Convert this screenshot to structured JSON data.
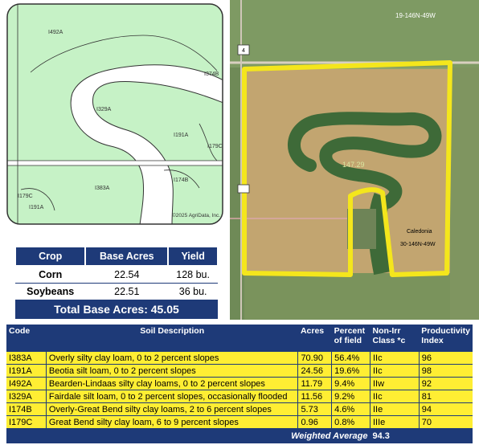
{
  "soil_map": {
    "labels": [
      "I492A",
      "I329A",
      "I191A",
      "I179C",
      "I383A",
      "I174B",
      "I179C",
      "I191A",
      "I374B"
    ],
    "copyright": "©2025 AgriData, Inc."
  },
  "aerial": {
    "section_top": "19-146N-49W",
    "road_label": "4",
    "acreage": "147.29",
    "place": "Caledonia",
    "section_bottom": "30-146N-49W"
  },
  "base_acres": {
    "headers": [
      "Crop",
      "Base Acres",
      "Yield"
    ],
    "rows": [
      {
        "crop": "Corn",
        "acres": "22.54",
        "yield": "128 bu."
      },
      {
        "crop": "Soybeans",
        "acres": "22.51",
        "yield": "36 bu."
      }
    ],
    "total": "Total Base Acres: 45.05"
  },
  "soil_table": {
    "headers": {
      "code": "Code",
      "desc": "Soil Description",
      "acres": "Acres",
      "pct": "Percent of field",
      "cls": "Non-Irr Class *c",
      "prod": "Productivity Index"
    },
    "rows": [
      {
        "code": "I383A",
        "desc": "Overly silty clay loam, 0 to 2 percent slopes",
        "acres": "70.90",
        "pct": "56.4%",
        "cls": "IIc",
        "prod": "96"
      },
      {
        "code": "I191A",
        "desc": "Beotia silt loam, 0 to 2 percent slopes",
        "acres": "24.56",
        "pct": "19.6%",
        "cls": "IIc",
        "prod": "98"
      },
      {
        "code": "I492A",
        "desc": "Bearden-Lindaas silty clay loams, 0 to 2 percent slopes",
        "acres": "11.79",
        "pct": "9.4%",
        "cls": "IIw",
        "prod": "92"
      },
      {
        "code": "I329A",
        "desc": "Fairdale silt loam, 0 to 2 percent slopes, occasionally flooded",
        "acres": "11.56",
        "pct": "9.2%",
        "cls": "IIc",
        "prod": "81"
      },
      {
        "code": "I174B",
        "desc": "Overly-Great Bend silty clay loams, 2 to 6 percent slopes",
        "acres": "5.73",
        "pct": "4.6%",
        "cls": "IIe",
        "prod": "94"
      },
      {
        "code": "I179C",
        "desc": "Great Bend silty clay loam, 6 to 9 percent slopes",
        "acres": "0.96",
        "pct": "0.8%",
        "cls": "IIIe",
        "prod": "70"
      }
    ],
    "weighted_label": "Weighted Average",
    "weighted_value": "94.3"
  }
}
